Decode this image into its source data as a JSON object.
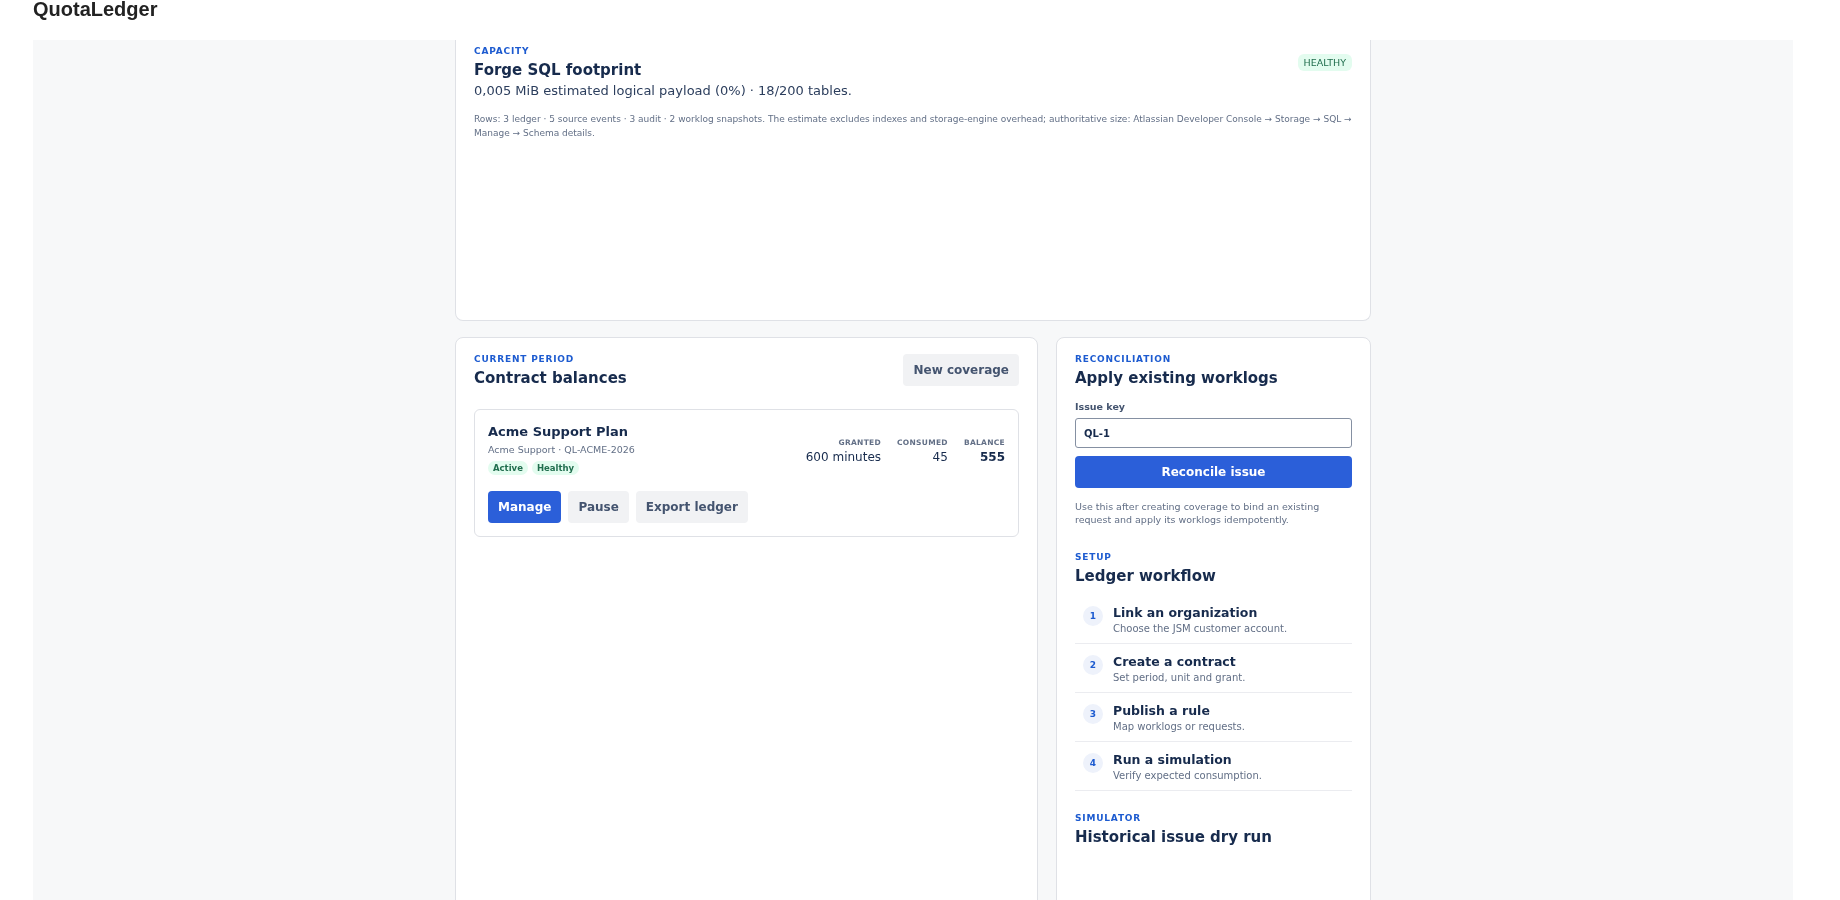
{
  "app": {
    "title": "QuotaLedger"
  },
  "capacity": {
    "eyebrow": "CAPACITY",
    "title": "Forge SQL footprint",
    "badge": "HEALTHY",
    "summary": "0,005 MiB estimated logical payload (0%) · 18/200 tables.",
    "note": "Rows: 3 ledger · 5 source events · 3 audit · 2 worklog snapshots. The estimate excludes indexes and storage-engine overhead; authoritative size: Atlassian Developer Console → Storage → SQL → Manage → Schema details."
  },
  "balances": {
    "eyebrow": "CURRENT PERIOD",
    "title": "Contract balances",
    "action": "New coverage",
    "contracts": [
      {
        "name": "Acme Support Plan",
        "meta": "Acme Support · QL-ACME-2026",
        "tags": [
          "Active",
          "Healthy"
        ],
        "stats": [
          {
            "label": "GRANTED",
            "value": "600 minutes",
            "emphasis": false
          },
          {
            "label": "CONSUMED",
            "value": "45",
            "emphasis": false
          },
          {
            "label": "BALANCE",
            "value": "555",
            "emphasis": true
          }
        ],
        "buttons": [
          {
            "label": "Manage",
            "primary": true
          },
          {
            "label": "Pause",
            "primary": false
          },
          {
            "label": "Export ledger",
            "primary": false
          }
        ]
      }
    ]
  },
  "reconciliation": {
    "eyebrow": "RECONCILIATION",
    "title": "Apply existing worklogs",
    "field_label": "Issue key",
    "value": "QL-1",
    "button": "Reconcile issue",
    "help": "Use this after creating coverage to bind an existing request and apply its worklogs idempotently."
  },
  "setup": {
    "eyebrow": "SETUP",
    "title": "Ledger workflow",
    "steps": [
      {
        "number": "1",
        "title": "Link an organization",
        "description": "Choose the JSM customer account."
      },
      {
        "number": "2",
        "title": "Create a contract",
        "description": "Set period, unit and grant."
      },
      {
        "number": "3",
        "title": "Publish a rule",
        "description": "Map worklogs or requests."
      },
      {
        "number": "4",
        "title": "Run a simulation",
        "description": "Verify expected consumption."
      }
    ]
  },
  "simulator": {
    "eyebrow": "SIMULATOR",
    "title": "Historical issue dry run"
  }
}
